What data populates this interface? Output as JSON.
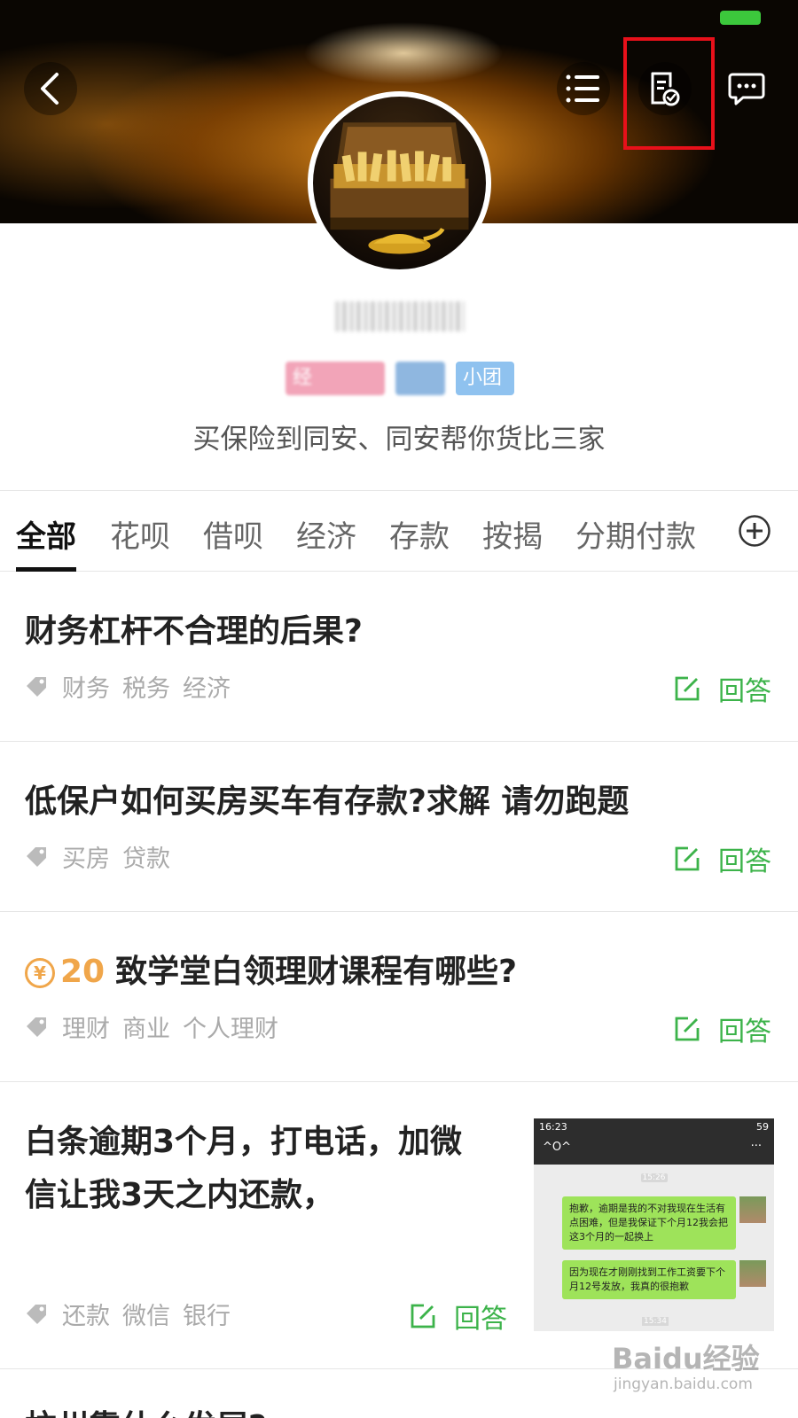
{
  "header": {
    "back_icon": "chevron-left-icon",
    "list_icon": "list-icon",
    "report_icon": "document-check-icon",
    "message_icon": "message-icon",
    "highlight_color": "#e8101a"
  },
  "profile": {
    "badges": [
      "经",
      "",
      "小团"
    ],
    "intro": "买保险到同安、同安帮你货比三家"
  },
  "tabs": [
    "全部",
    "花呗",
    "借呗",
    "经济",
    "存款",
    "按揭",
    "分期付款"
  ],
  "tab_add_icon": "plus-circle-icon",
  "answer_label": "回答",
  "questions": [
    {
      "title": "财务杠杆不合理的后果?",
      "tags": [
        "财务",
        "税务",
        "经济"
      ]
    },
    {
      "title": "低保户如何买房买车有存款?求解 请勿跑题",
      "tags": [
        "买房",
        "贷款"
      ]
    },
    {
      "reward_symbol": "¥",
      "reward": "20",
      "title": "致学堂白领理财课程有哪些?",
      "tags": [
        "理财",
        "商业",
        "个人理财"
      ]
    },
    {
      "title_line1": "白条逾期3个月，打电话，加微",
      "title_line2": "信让我3天之内还款，",
      "tags": [
        "还款",
        "微信",
        "银行"
      ]
    },
    {
      "title": "杭州靠什么发展?"
    }
  ],
  "thumbnail": {
    "time": "16:23",
    "status_right": "59",
    "title": "^O^",
    "more": "···",
    "stamp1": "15:26",
    "bubble1": "抱歉，逾期是我的不对我现在生活有点困难，但是我保证下个月12我会把这3个月的一起换上",
    "bubble2": "因为现在才刚刚找到工作工资要下个月12号发放，我真的很抱歉",
    "stamp2": "15:34"
  },
  "watermark": {
    "text": "Baidu经验",
    "sub": "jingyan.baidu.com"
  },
  "colors": {
    "accent_green": "#3cb34a",
    "reward_orange": "#f0a64a"
  }
}
